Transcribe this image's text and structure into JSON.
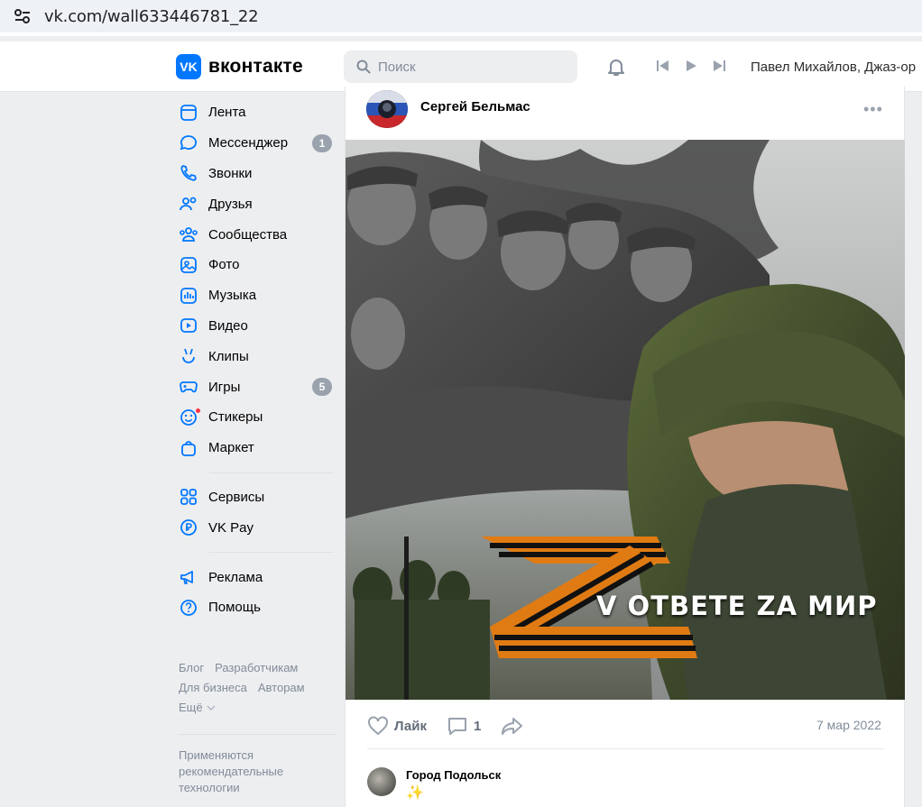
{
  "browser": {
    "url": "vk.com/wall633446781_22"
  },
  "header": {
    "logo_mark": "VK",
    "logo_text": "вконтакте",
    "search_placeholder": "Поиск",
    "now_playing": "Павел Михайлов, Джаз-ор"
  },
  "nav": {
    "items": [
      {
        "label": "Лента",
        "icon": "feed-icon"
      },
      {
        "label": "Мессенджер",
        "icon": "messenger-icon",
        "badge": "1"
      },
      {
        "label": "Звонки",
        "icon": "phone-icon"
      },
      {
        "label": "Друзья",
        "icon": "friends-icon"
      },
      {
        "label": "Сообщества",
        "icon": "communities-icon"
      },
      {
        "label": "Фото",
        "icon": "photo-icon"
      },
      {
        "label": "Музыка",
        "icon": "music-icon"
      },
      {
        "label": "Видео",
        "icon": "video-icon"
      },
      {
        "label": "Клипы",
        "icon": "clips-icon"
      },
      {
        "label": "Игры",
        "icon": "games-icon",
        "badge": "5"
      },
      {
        "label": "Стикеры",
        "icon": "stickers-icon"
      },
      {
        "label": "Маркет",
        "icon": "market-icon"
      }
    ],
    "items2": [
      {
        "label": "Сервисы",
        "icon": "services-icon"
      },
      {
        "label": "VK Pay",
        "icon": "vkpay-icon"
      }
    ],
    "items3": [
      {
        "label": "Реклама",
        "icon": "ads-icon"
      },
      {
        "label": "Помощь",
        "icon": "help-icon"
      }
    ],
    "footer_links": [
      "Блог",
      "Разработчикам",
      "Для бизнеса",
      "Авторам",
      "Ещё"
    ],
    "recommend_text": "Применяются рекомендательные технологии"
  },
  "post": {
    "author": "Сергей Бельмас",
    "image_caption": "V ОТВЕТЕ ZA МИР",
    "like_label": "Лайк",
    "comments_count": "1",
    "date": "7 мар 2022",
    "comment": {
      "author": "Город Подольск",
      "text": "✨"
    }
  },
  "colors": {
    "accent": "#0077ff",
    "badge": "#99a2ad",
    "background": "#edeef0"
  }
}
